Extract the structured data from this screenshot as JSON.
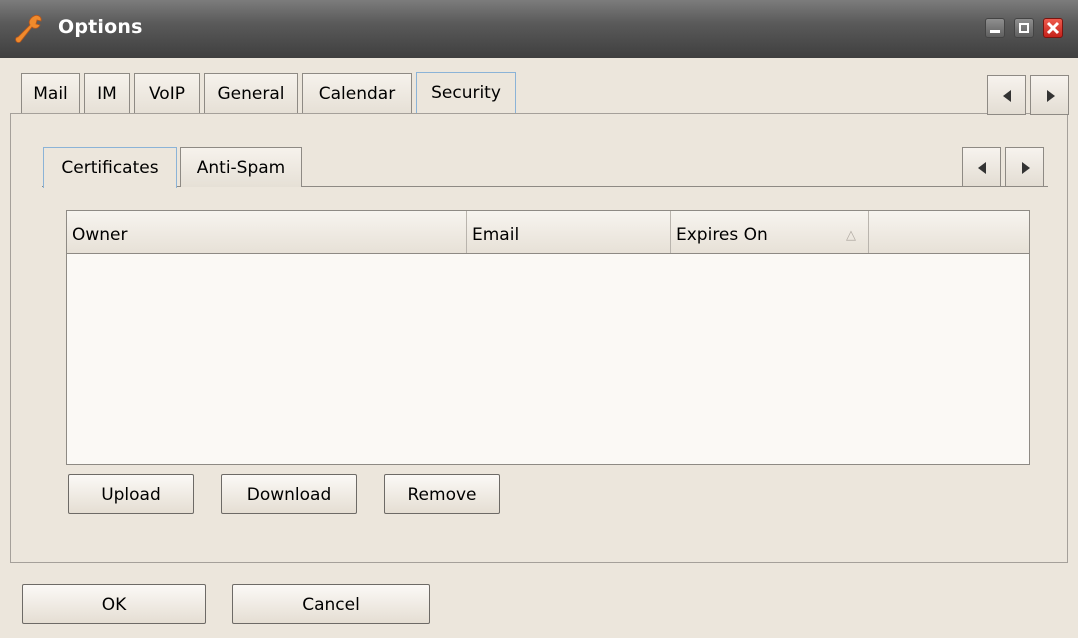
{
  "window": {
    "title": "Options",
    "icon": "wrench-icon",
    "controls": [
      "minimize-icon",
      "maximize-icon",
      "close-icon"
    ],
    "accent_close": "#d3302a"
  },
  "outer_tabs": {
    "items": [
      {
        "label": "Mail"
      },
      {
        "label": "IM"
      },
      {
        "label": "VoIP"
      },
      {
        "label": "General"
      },
      {
        "label": "Calendar"
      },
      {
        "label": "Security",
        "active": true
      }
    ]
  },
  "inner_tabs": {
    "items": [
      {
        "label": "Certificates",
        "active": true
      },
      {
        "label": "Anti-Spam"
      }
    ]
  },
  "certificates_table": {
    "columns": [
      {
        "label": "Owner"
      },
      {
        "label": "Email"
      },
      {
        "label": "Expires On",
        "sorted": "ascending"
      },
      {
        "label": ""
      }
    ],
    "rows": []
  },
  "actions": {
    "upload_label": "Upload",
    "download_label": "Download",
    "remove_label": "Remove"
  },
  "footer": {
    "ok_label": "OK",
    "cancel_label": "Cancel"
  }
}
